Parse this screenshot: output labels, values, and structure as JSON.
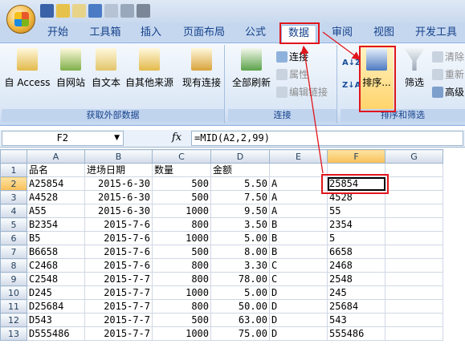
{
  "quick_access": [
    "save-icon",
    "open-icon",
    "mail-icon",
    "undo-icon",
    "redo-icon",
    "print-preview-icon",
    "print-icon"
  ],
  "tabs": [
    "开始",
    "工具箱",
    "插入",
    "页面布局",
    "公式",
    "数据",
    "审阅",
    "视图",
    "开发工具"
  ],
  "active_tab": "数据",
  "ribbon": {
    "external": {
      "buttons": [
        "自 Access",
        "自网站",
        "自文本",
        "自其他来源",
        "现有连接"
      ],
      "label": "获取外部数据"
    },
    "connections": {
      "refresh": "全部刷新",
      "small": [
        "连接",
        "属性",
        "编辑链接"
      ],
      "label": "连接"
    },
    "sort": {
      "sort_az": "A↓Z",
      "sort_za": "Z↓A",
      "sort": "排序...",
      "filter": "筛选",
      "small": [
        "清除",
        "重新",
        "高级"
      ],
      "label": "排序和筛选"
    }
  },
  "formula_bar": {
    "name_box": "F2",
    "fx": "fx",
    "formula": "=MID(A2,2,99)"
  },
  "columns": [
    "A",
    "B",
    "C",
    "D",
    "E",
    "F",
    "G"
  ],
  "rows": [
    [
      "品名",
      "进场日期",
      "数量",
      "金额",
      "",
      "",
      ""
    ],
    [
      "A25854",
      "2015-6-30",
      "500",
      "5.50",
      "A",
      "25854",
      ""
    ],
    [
      "A4528",
      "2015-6-30",
      "500",
      "7.50",
      "A",
      "4528",
      ""
    ],
    [
      "A55",
      "2015-6-30",
      "1000",
      "9.50",
      "A",
      "55",
      ""
    ],
    [
      "B2354",
      "2015-7-6",
      "800",
      "3.50",
      "B",
      "2354",
      ""
    ],
    [
      "B5",
      "2015-7-6",
      "1000",
      "5.00",
      "B",
      "5",
      ""
    ],
    [
      "B6658",
      "2015-7-6",
      "500",
      "8.00",
      "B",
      "6658",
      ""
    ],
    [
      "C2468",
      "2015-7-6",
      "800",
      "3.30",
      "C",
      "2468",
      ""
    ],
    [
      "C2548",
      "2015-7-7",
      "800",
      "78.00",
      "C",
      "2548",
      ""
    ],
    [
      "D245",
      "2015-7-7",
      "1000",
      "5.00",
      "D",
      "245",
      ""
    ],
    [
      "D25684",
      "2015-7-7",
      "800",
      "50.00",
      "D",
      "25684",
      ""
    ],
    [
      "D543",
      "2015-7-7",
      "500",
      "63.00",
      "D",
      "543",
      ""
    ],
    [
      "D555486",
      "2015-7-7",
      "1000",
      "75.00",
      "D",
      "555486",
      ""
    ]
  ],
  "row_numbers": [
    "1",
    "2",
    "3",
    "4",
    "5",
    "6",
    "7",
    "8",
    "9",
    "10",
    "11",
    "12",
    "13"
  ],
  "selected_cell": "F2",
  "colors": {
    "annotation": "#e0161c",
    "accent": "#15428b",
    "selected_header": "#f8c057"
  }
}
